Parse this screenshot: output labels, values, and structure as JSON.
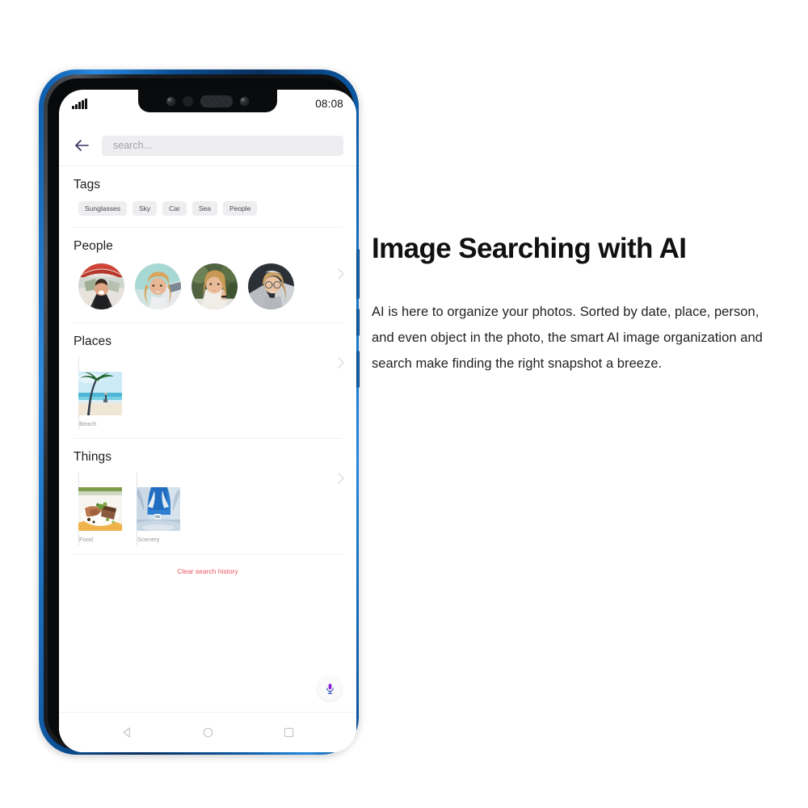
{
  "phone": {
    "status_bar": {
      "time": "08:08",
      "signal_icon": "cellular-signal-icon"
    },
    "notch": {
      "front_camera_icon": "front-camera-icon",
      "sensor_icon": "proximity-sensor-icon",
      "speaker_icon": "earpiece-speaker-icon",
      "second_camera_icon": "secondary-camera-icon"
    },
    "app_bar": {
      "back_icon": "back-arrow-icon",
      "search_value": "",
      "search_placeholder": "search..."
    },
    "sections": [
      {
        "key": "tags",
        "title": "Tags",
        "chips": [
          "Sunglasses",
          "Sky",
          "Car",
          "Sea",
          "People"
        ]
      },
      {
        "key": "people",
        "title": "People",
        "chevron_icon": "chevron-right-icon",
        "avatars": [
          {
            "name": "person-avatar-1",
            "alt": "Woman laughing under red umbrella"
          },
          {
            "name": "person-avatar-2",
            "alt": "Blonde curly haired woman, teal background"
          },
          {
            "name": "person-avatar-3",
            "alt": "Woman with hand on cheek, greenery background"
          },
          {
            "name": "person-avatar-4",
            "alt": "Woman with glasses laughing, dark top"
          }
        ]
      },
      {
        "key": "places",
        "title": "Places",
        "chevron_icon": "chevron-right-icon",
        "tiles": [
          {
            "label": "Beach",
            "thumb": "beach-thumbnail"
          }
        ]
      },
      {
        "key": "things",
        "title": "Things",
        "chevron_icon": "chevron-right-icon",
        "tiles": [
          {
            "label": "Food",
            "thumb": "food-thumbnail"
          },
          {
            "label": "Scenery",
            "thumb": "scenery-thumbnail"
          }
        ]
      }
    ],
    "clear_history_label": "Clear search history",
    "mic_button": {
      "icon": "microphone-icon",
      "label": "Voice search"
    },
    "nav_bar": {
      "back_icon": "nav-back-triangle-icon",
      "home_icon": "nav-home-circle-icon",
      "recents_icon": "nav-recents-square-icon"
    }
  },
  "copy": {
    "heading": "Image Searching with AI",
    "body": "AI is here to organize your photos. Sorted by date, place, person, and even object in the photo, the smart AI image organization and search make finding the right snapshot a breeze."
  },
  "colors": {
    "frame_blue": "#0a58a6",
    "accent_red": "#e8555f",
    "chip_bg": "#eeeef0",
    "mic_purple": "#8a1fd8",
    "mic_blue": "#2d4fb8",
    "text_primary": "#1c1c1e",
    "text_muted": "#9a9a9e"
  }
}
